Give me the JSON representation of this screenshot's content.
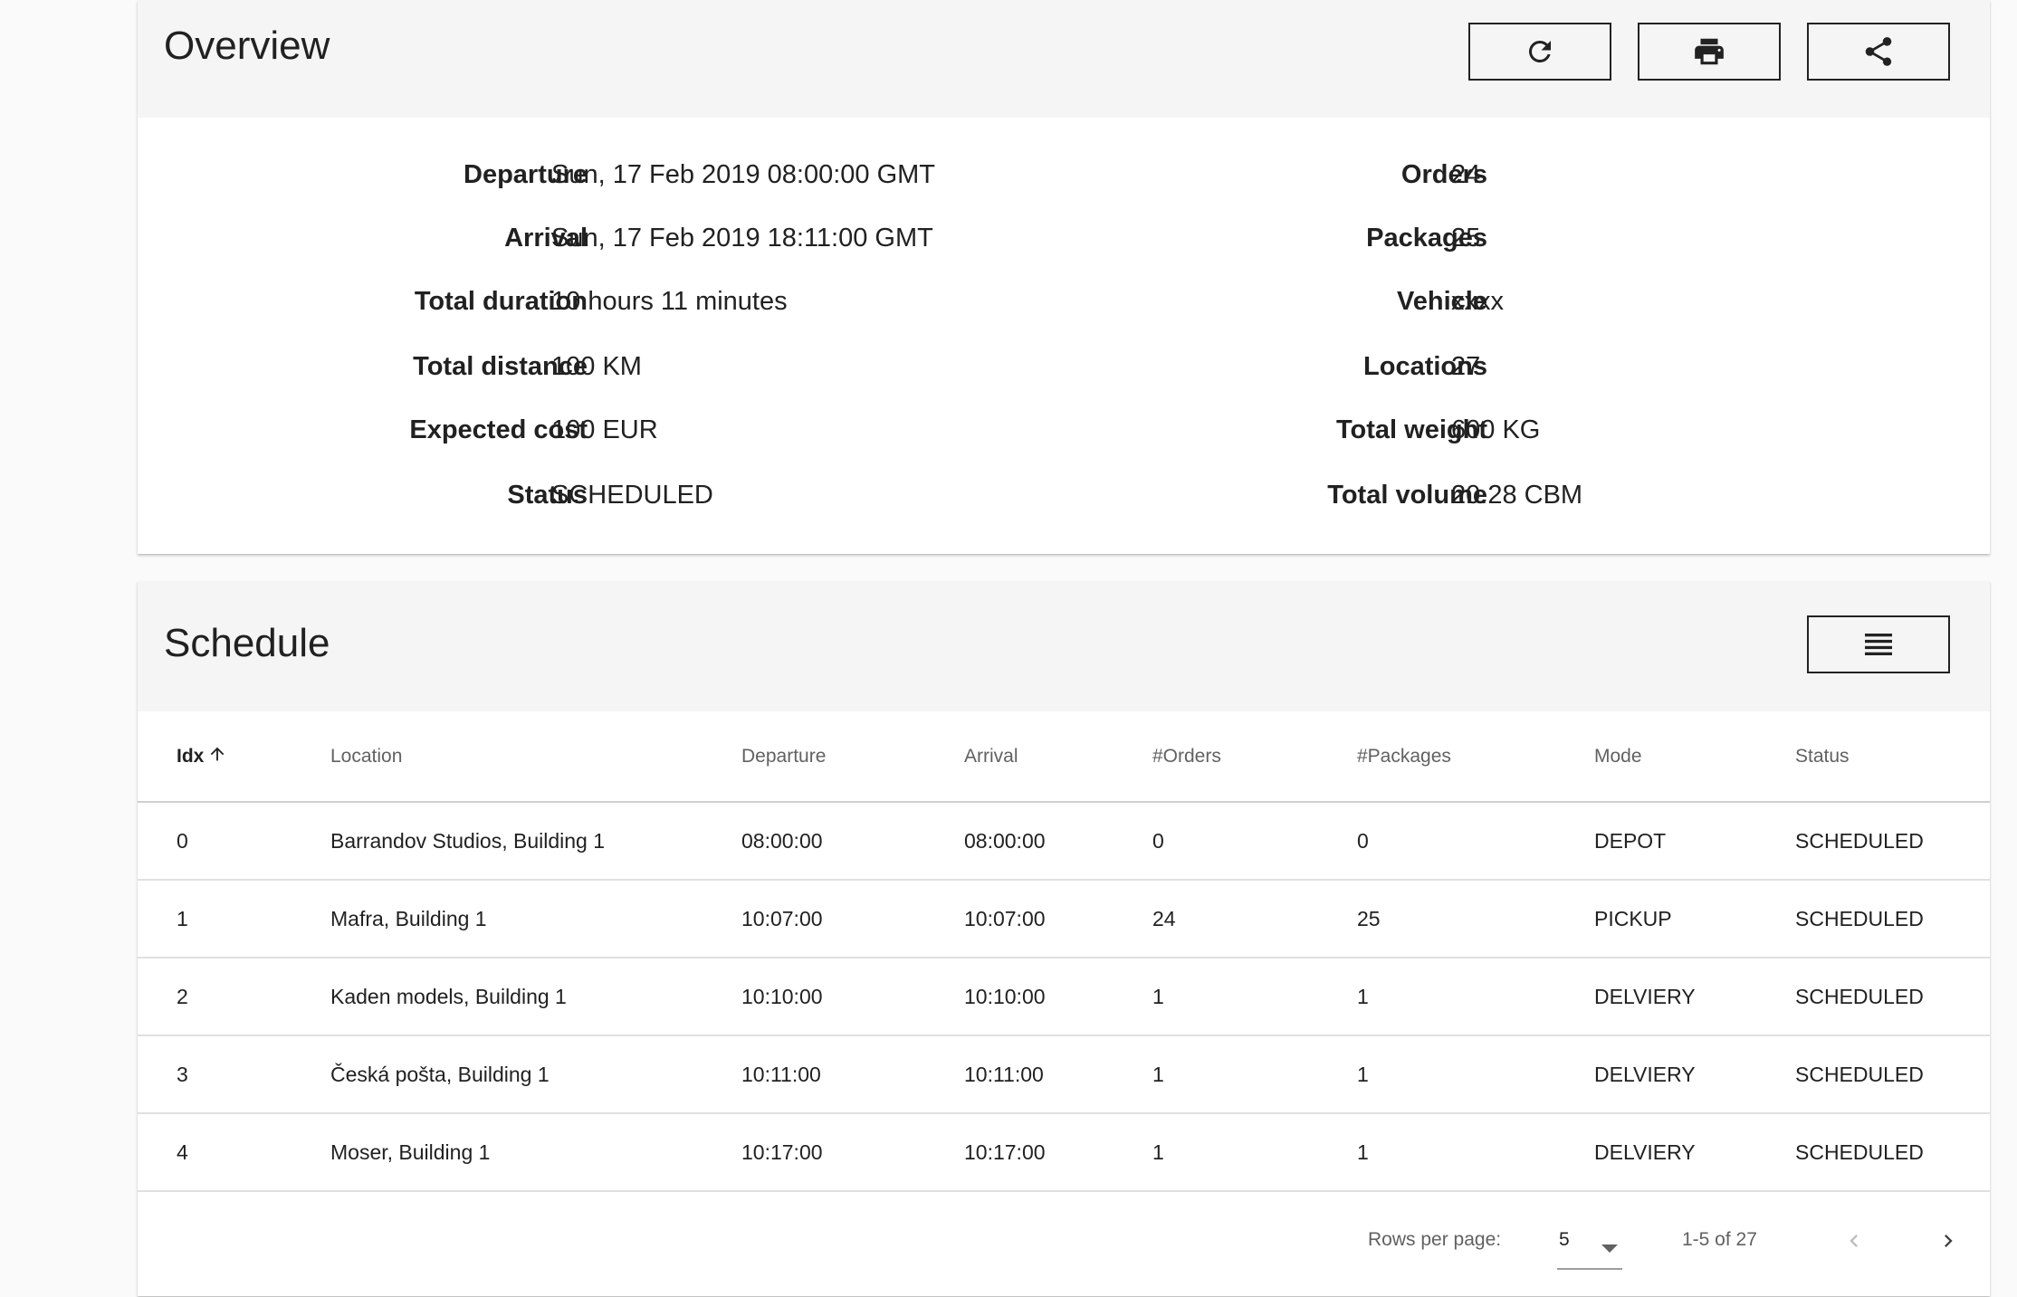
{
  "overview": {
    "title": "Overview",
    "actions": {
      "refresh_icon": "refresh-icon",
      "print_icon": "print-icon",
      "share_icon": "share-icon"
    },
    "left": [
      {
        "label": "Departure",
        "value": "Sun, 17 Feb 2019 08:00:00 GMT"
      },
      {
        "label": "Arrival",
        "value": "Sun, 17 Feb 2019 18:11:00 GMT"
      },
      {
        "label": "Total duration",
        "value": "10 hours 11 minutes"
      },
      {
        "label": "Total distance",
        "value": "100 KM"
      },
      {
        "label": "Expected cost",
        "value": "100 EUR"
      },
      {
        "label": "Status",
        "value": "SCHEDULED"
      }
    ],
    "right": [
      {
        "label": "Orders",
        "value": "24"
      },
      {
        "label": "Packages",
        "value": "25"
      },
      {
        "label": "Vehicle",
        "value": "xxxx"
      },
      {
        "label": "Locations",
        "value": "27"
      },
      {
        "label": "Total weight",
        "value": "600 KG"
      },
      {
        "label": "Total volume",
        "value": "20.28 CBM"
      }
    ]
  },
  "schedule": {
    "title": "Schedule",
    "columns_icon": "view-columns-icon",
    "columns": [
      "Idx",
      "Location",
      "Departure",
      "Arrival",
      "#Orders",
      "#Packages",
      "Mode",
      "Status"
    ],
    "sort_column": "Idx",
    "sort_direction": "ascending",
    "rows": [
      [
        "0",
        "Barrandov Studios, Building 1",
        "08:00:00",
        "08:00:00",
        "0",
        "0",
        "DEPOT",
        "SCHEDULED"
      ],
      [
        "1",
        "Mafra, Building 1",
        "10:07:00",
        "10:07:00",
        "24",
        "25",
        "PICKUP",
        "SCHEDULED"
      ],
      [
        "2",
        "Kaden models, Building 1",
        "10:10:00",
        "10:10:00",
        "1",
        "1",
        "DELVIERY",
        "SCHEDULED"
      ],
      [
        "3",
        "Česká pošta, Building 1",
        "10:11:00",
        "10:11:00",
        "1",
        "1",
        "DELVIERY",
        "SCHEDULED"
      ],
      [
        "4",
        "Moser, Building 1",
        "10:17:00",
        "10:17:00",
        "1",
        "1",
        "DELVIERY",
        "SCHEDULED"
      ]
    ],
    "pagination": {
      "rows_per_page_label": "Rows per page:",
      "rows_per_page": "5",
      "range": "1-5 of 27"
    }
  },
  "colors": {
    "page_bg": "#fafafa",
    "header_bg": "#f5f5f5",
    "text": "#212121",
    "muted_text": "#616161"
  }
}
